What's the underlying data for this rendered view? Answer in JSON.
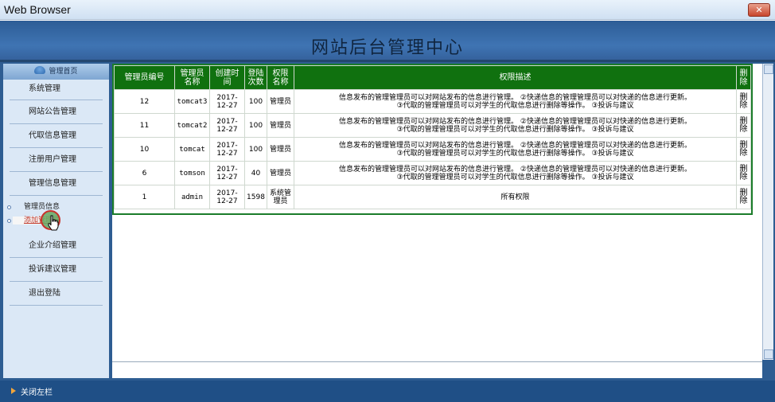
{
  "window": {
    "title": "Web Browser",
    "close_label": "✕"
  },
  "header": {
    "title": "网站后台管理中心"
  },
  "sidebar": {
    "home_label": "管理首页",
    "items": [
      {
        "label": "系统管理"
      },
      {
        "label": "网站公告管理"
      },
      {
        "label": "代取信息管理"
      },
      {
        "label": "注册用户管理"
      },
      {
        "label": "管理信息管理"
      }
    ],
    "sub_items": [
      {
        "label": "管理员信息"
      },
      {
        "label": "添加管理员"
      }
    ],
    "items_after": [
      {
        "label": "企业介绍管理"
      },
      {
        "label": "投诉建议管理"
      },
      {
        "label": "退出登陆"
      }
    ]
  },
  "table": {
    "headers": [
      "管理员编号",
      "管理员名称",
      "创建时间",
      "登陆次数",
      "权限名称",
      "权限描述",
      "删除"
    ],
    "rows": [
      {
        "id": "12",
        "name": "tomcat3",
        "date": "2017-12-27",
        "logins": "100",
        "role": "管理员",
        "perm_line1": "信息发布的管理管理员可以对网站发布的信息进行管理。 ②快递信息的管理管理员可以对快递的信息进行更新。",
        "perm_line2": "③代取的管理管理员可以对学生的代取信息进行删除等操作。 ③投诉与建议",
        "delete": "删除"
      },
      {
        "id": "11",
        "name": "tomcat2",
        "date": "2017-12-27",
        "logins": "100",
        "role": "管理员",
        "perm_line1": "信息发布的管理管理员可以对网站发布的信息进行管理。 ②快递信息的管理管理员可以对快递的信息进行更新。",
        "perm_line2": "③代取的管理管理员可以对学生的代取信息进行删除等操作。 ③投诉与建议",
        "delete": "删除"
      },
      {
        "id": "10",
        "name": "tomcat",
        "date": "2017-12-27",
        "logins": "100",
        "role": "管理员",
        "perm_line1": "信息发布的管理管理员可以对网站发布的信息进行管理。 ②快递信息的管理管理员可以对快递的信息进行更新。",
        "perm_line2": "③代取的管理管理员可以对学生的代取信息进行删除等操作。 ③投诉与建议",
        "delete": "删除"
      },
      {
        "id": "6",
        "name": "tomson",
        "date": "2017-12-27",
        "logins": "40",
        "role": "管理员",
        "perm_line1": "信息发布的管理管理员可以对网站发布的信息进行管理。 ②快递信息的管理管理员可以对快递的信息进行更新。",
        "perm_line2": "③代取的管理管理员可以对学生的代取信息进行删除等操作。 ③投诉与建议",
        "delete": "删除"
      },
      {
        "id": "1",
        "name": "admin",
        "date": "2017-12-27",
        "logins": "1598",
        "role": "系统管理员",
        "perm_line1": "所有权限",
        "perm_line2": "",
        "delete": "删除"
      }
    ]
  },
  "footer": {
    "close_sidebar_label": "关闭左栏"
  },
  "colors": {
    "header_blue": "#3f74b3",
    "table_header_green": "#10710f",
    "bottom_bar": "#1f4f86"
  }
}
